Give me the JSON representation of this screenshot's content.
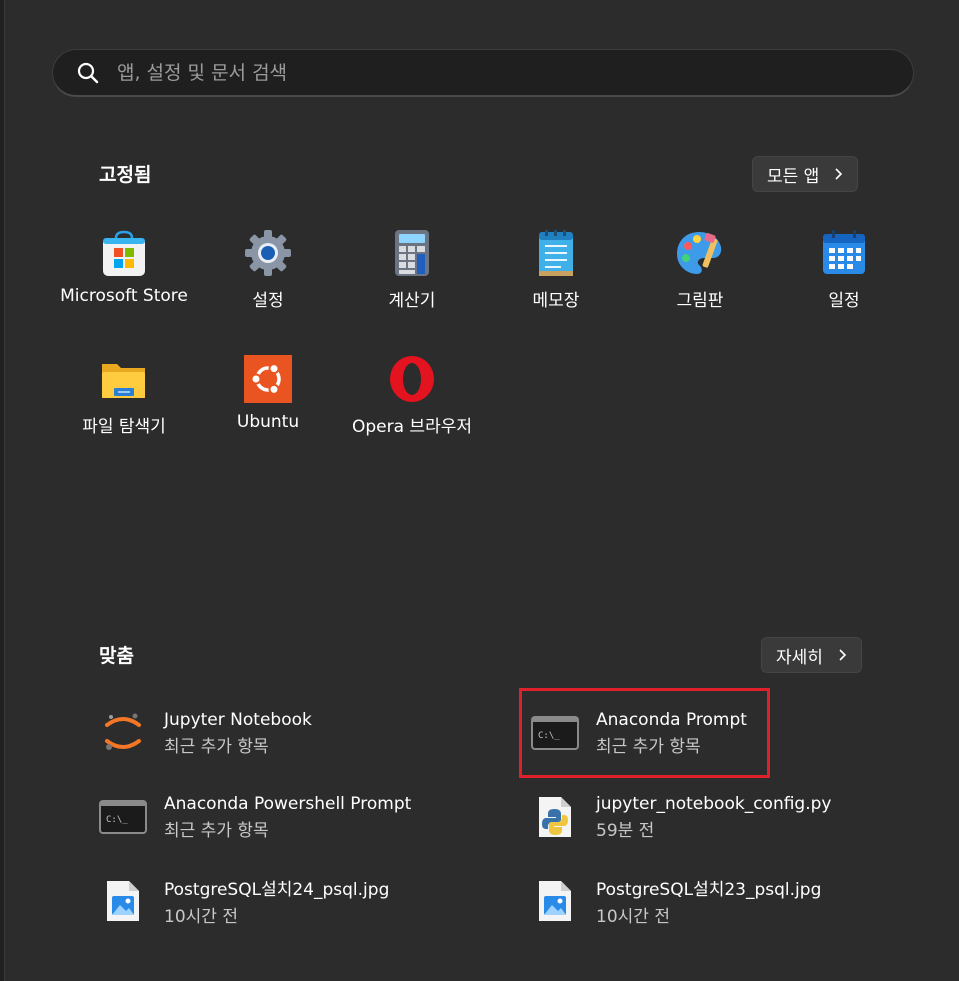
{
  "search": {
    "placeholder": "앱, 설정 및 문서 검색"
  },
  "pinned": {
    "title": "고정됨",
    "all_apps_label": "모든 앱",
    "apps": [
      {
        "label": "Microsoft Store",
        "icon": "microsoft-store-icon"
      },
      {
        "label": "설정",
        "icon": "settings-gear-icon"
      },
      {
        "label": "계산기",
        "icon": "calculator-icon"
      },
      {
        "label": "메모장",
        "icon": "notepad-icon"
      },
      {
        "label": "그림판",
        "icon": "paint-palette-icon"
      },
      {
        "label": "일정",
        "icon": "calendar-icon"
      },
      {
        "label": "파일 탐색기",
        "icon": "file-explorer-folder-icon"
      },
      {
        "label": "Ubuntu",
        "icon": "ubuntu-icon"
      },
      {
        "label": "Opera 브라우저",
        "icon": "opera-icon"
      }
    ]
  },
  "recommended": {
    "title": "맞춤",
    "more_label": "자세히",
    "items": [
      {
        "name": "Jupyter Notebook",
        "sub": "최근 추가 항목",
        "icon": "jupyter-icon"
      },
      {
        "name": "Anaconda Prompt",
        "sub": "최근 추가 항목",
        "icon": "terminal-icon"
      },
      {
        "name": "Anaconda Powershell Prompt",
        "sub": "최근 추가 항목",
        "icon": "terminal-icon"
      },
      {
        "name": "jupyter_notebook_config.py",
        "sub": "59분 전",
        "icon": "python-file-icon"
      },
      {
        "name": "PostgreSQL설치24_psql.jpg",
        "sub": "10시간 전",
        "icon": "image-file-icon"
      },
      {
        "name": "PostgreSQL설치23_psql.jpg",
        "sub": "10시간 전",
        "icon": "image-file-icon"
      }
    ]
  },
  "terminal_glyph": "C:\\_",
  "colors": {
    "highlight": "#e0202a",
    "background": "#2c2c2c"
  }
}
